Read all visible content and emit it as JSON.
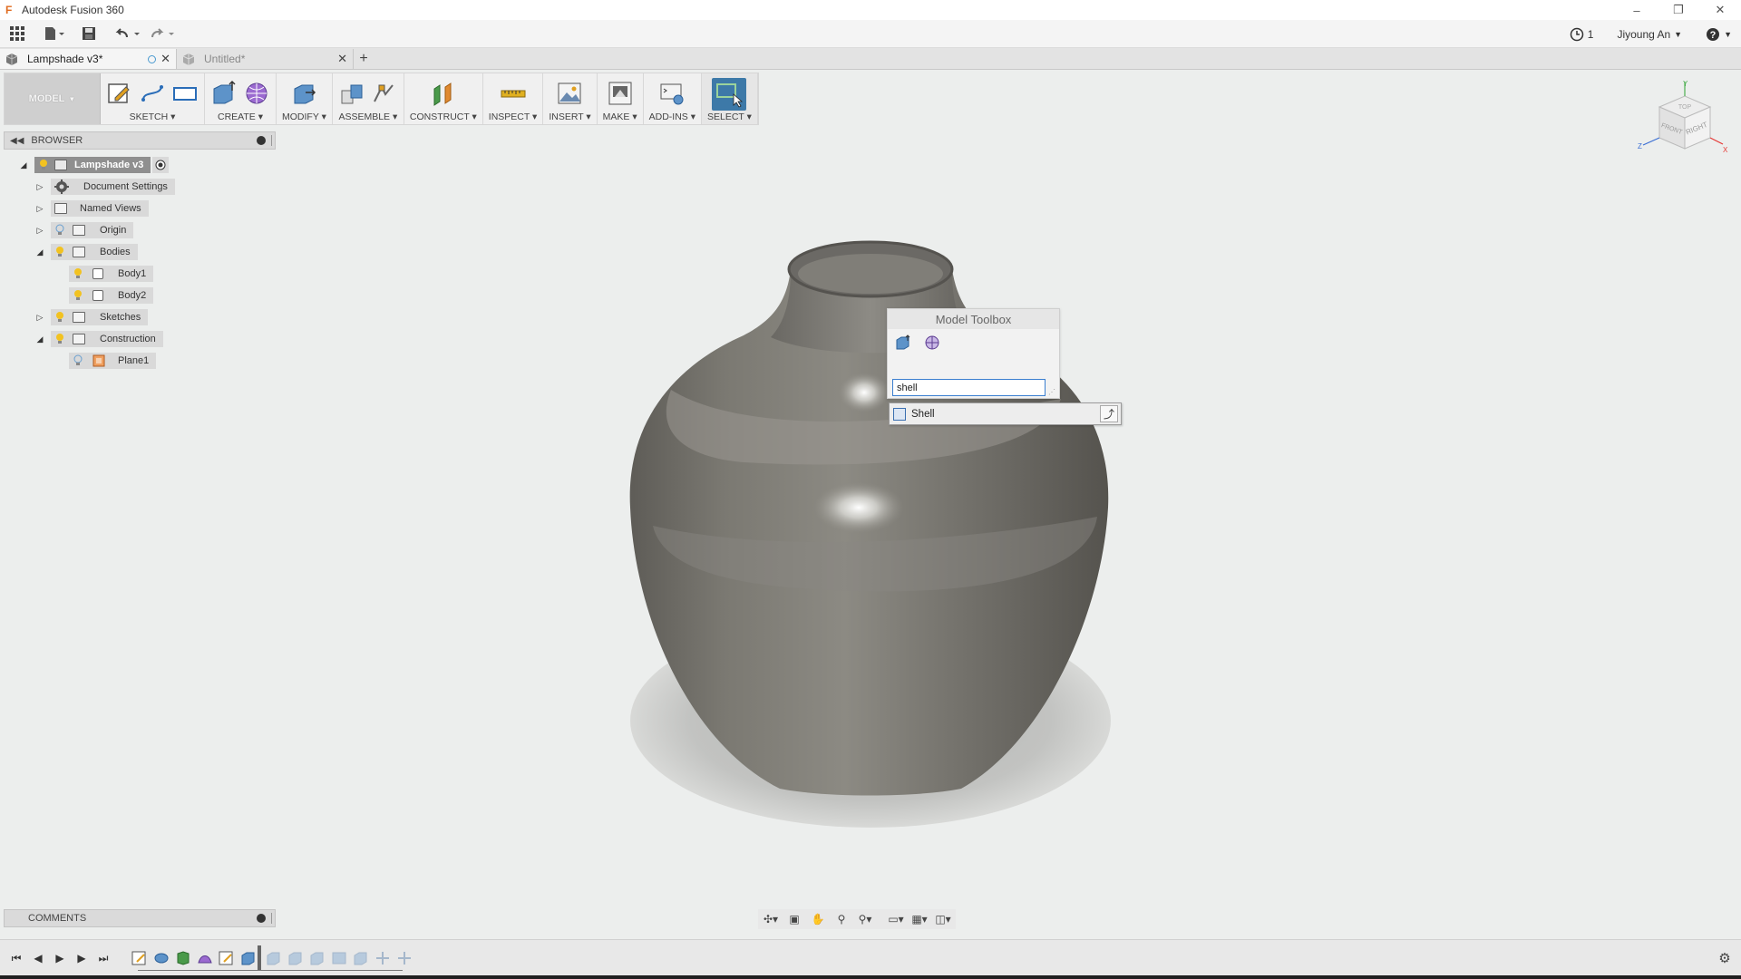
{
  "window": {
    "title": "Autodesk Fusion 360",
    "app_icon": "F"
  },
  "quick_access": {
    "job_status_count": "1",
    "user_name": "Jiyoung An"
  },
  "tabs": [
    {
      "label": "Lampshade v3*",
      "active": true
    },
    {
      "label": "Untitled*",
      "active": false
    }
  ],
  "toolbar": {
    "workspace": "MODEL",
    "groups": {
      "sketch": "SKETCH",
      "create": "CREATE",
      "modify": "MODIFY",
      "assemble": "ASSEMBLE",
      "construct": "CONSTRUCT",
      "inspect": "INSPECT",
      "insert": "INSERT",
      "make": "MAKE",
      "addins": "ADD-INS",
      "select": "SELECT"
    },
    "accent": "#3d79a8"
  },
  "browser": {
    "title": "BROWSER",
    "items": [
      {
        "label": "Lampshade v3"
      },
      {
        "label": "Document Settings"
      },
      {
        "label": "Named Views"
      },
      {
        "label": "Origin"
      },
      {
        "label": "Bodies"
      },
      {
        "label": "Body1"
      },
      {
        "label": "Body2"
      },
      {
        "label": "Sketches"
      },
      {
        "label": "Construction"
      },
      {
        "label": "Plane1"
      }
    ]
  },
  "viewcube": {
    "faces": [
      "TOP",
      "FRONT",
      "RIGHT"
    ],
    "axes": [
      "Y",
      "Z",
      "X"
    ]
  },
  "model_toolbox": {
    "title": "Model Toolbox",
    "search_value": "shell",
    "suggestion": "Shell"
  },
  "comments": {
    "title": "COMMENTS"
  }
}
